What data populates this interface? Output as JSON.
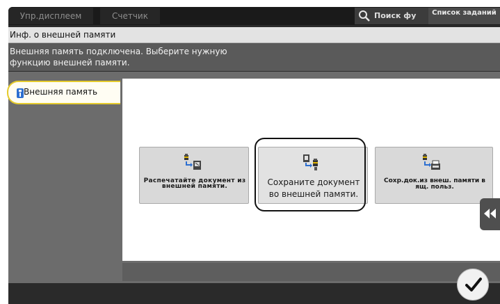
{
  "topbar": {
    "tab_ctrl": "Упр.дисплеем",
    "tab_counter": "Счетчик",
    "search_label": "Поиск фу",
    "search_icon": "magnifier-icon",
    "jobs_label": "Список заданий"
  },
  "header": {
    "title": "Инф. о внешней памяти",
    "message": "Внешняя память подключена. Выберите нужную функцию внешней памяти."
  },
  "sidebar": {
    "tab_label": "Внешняя память",
    "tab_icon": "usb-icon"
  },
  "functions": [
    {
      "label": "Распечатайте документ из внешней памяти.",
      "icon": "usb-to-printer-icon"
    },
    {
      "label": "Сохраните документ во внешней памяти.",
      "icon": "document-to-usb-icon"
    },
    {
      "label": "Сохр.док.из внеш. памяти в ящ. польз.",
      "icon": "usb-to-box-icon"
    }
  ],
  "controls": {
    "collapse_icon": "double-chevron-left-icon",
    "ok_icon": "checkmark-icon"
  },
  "colors": {
    "selected_tab_border": "#e5cb2c",
    "usb_blue": "#2d6fd0"
  }
}
